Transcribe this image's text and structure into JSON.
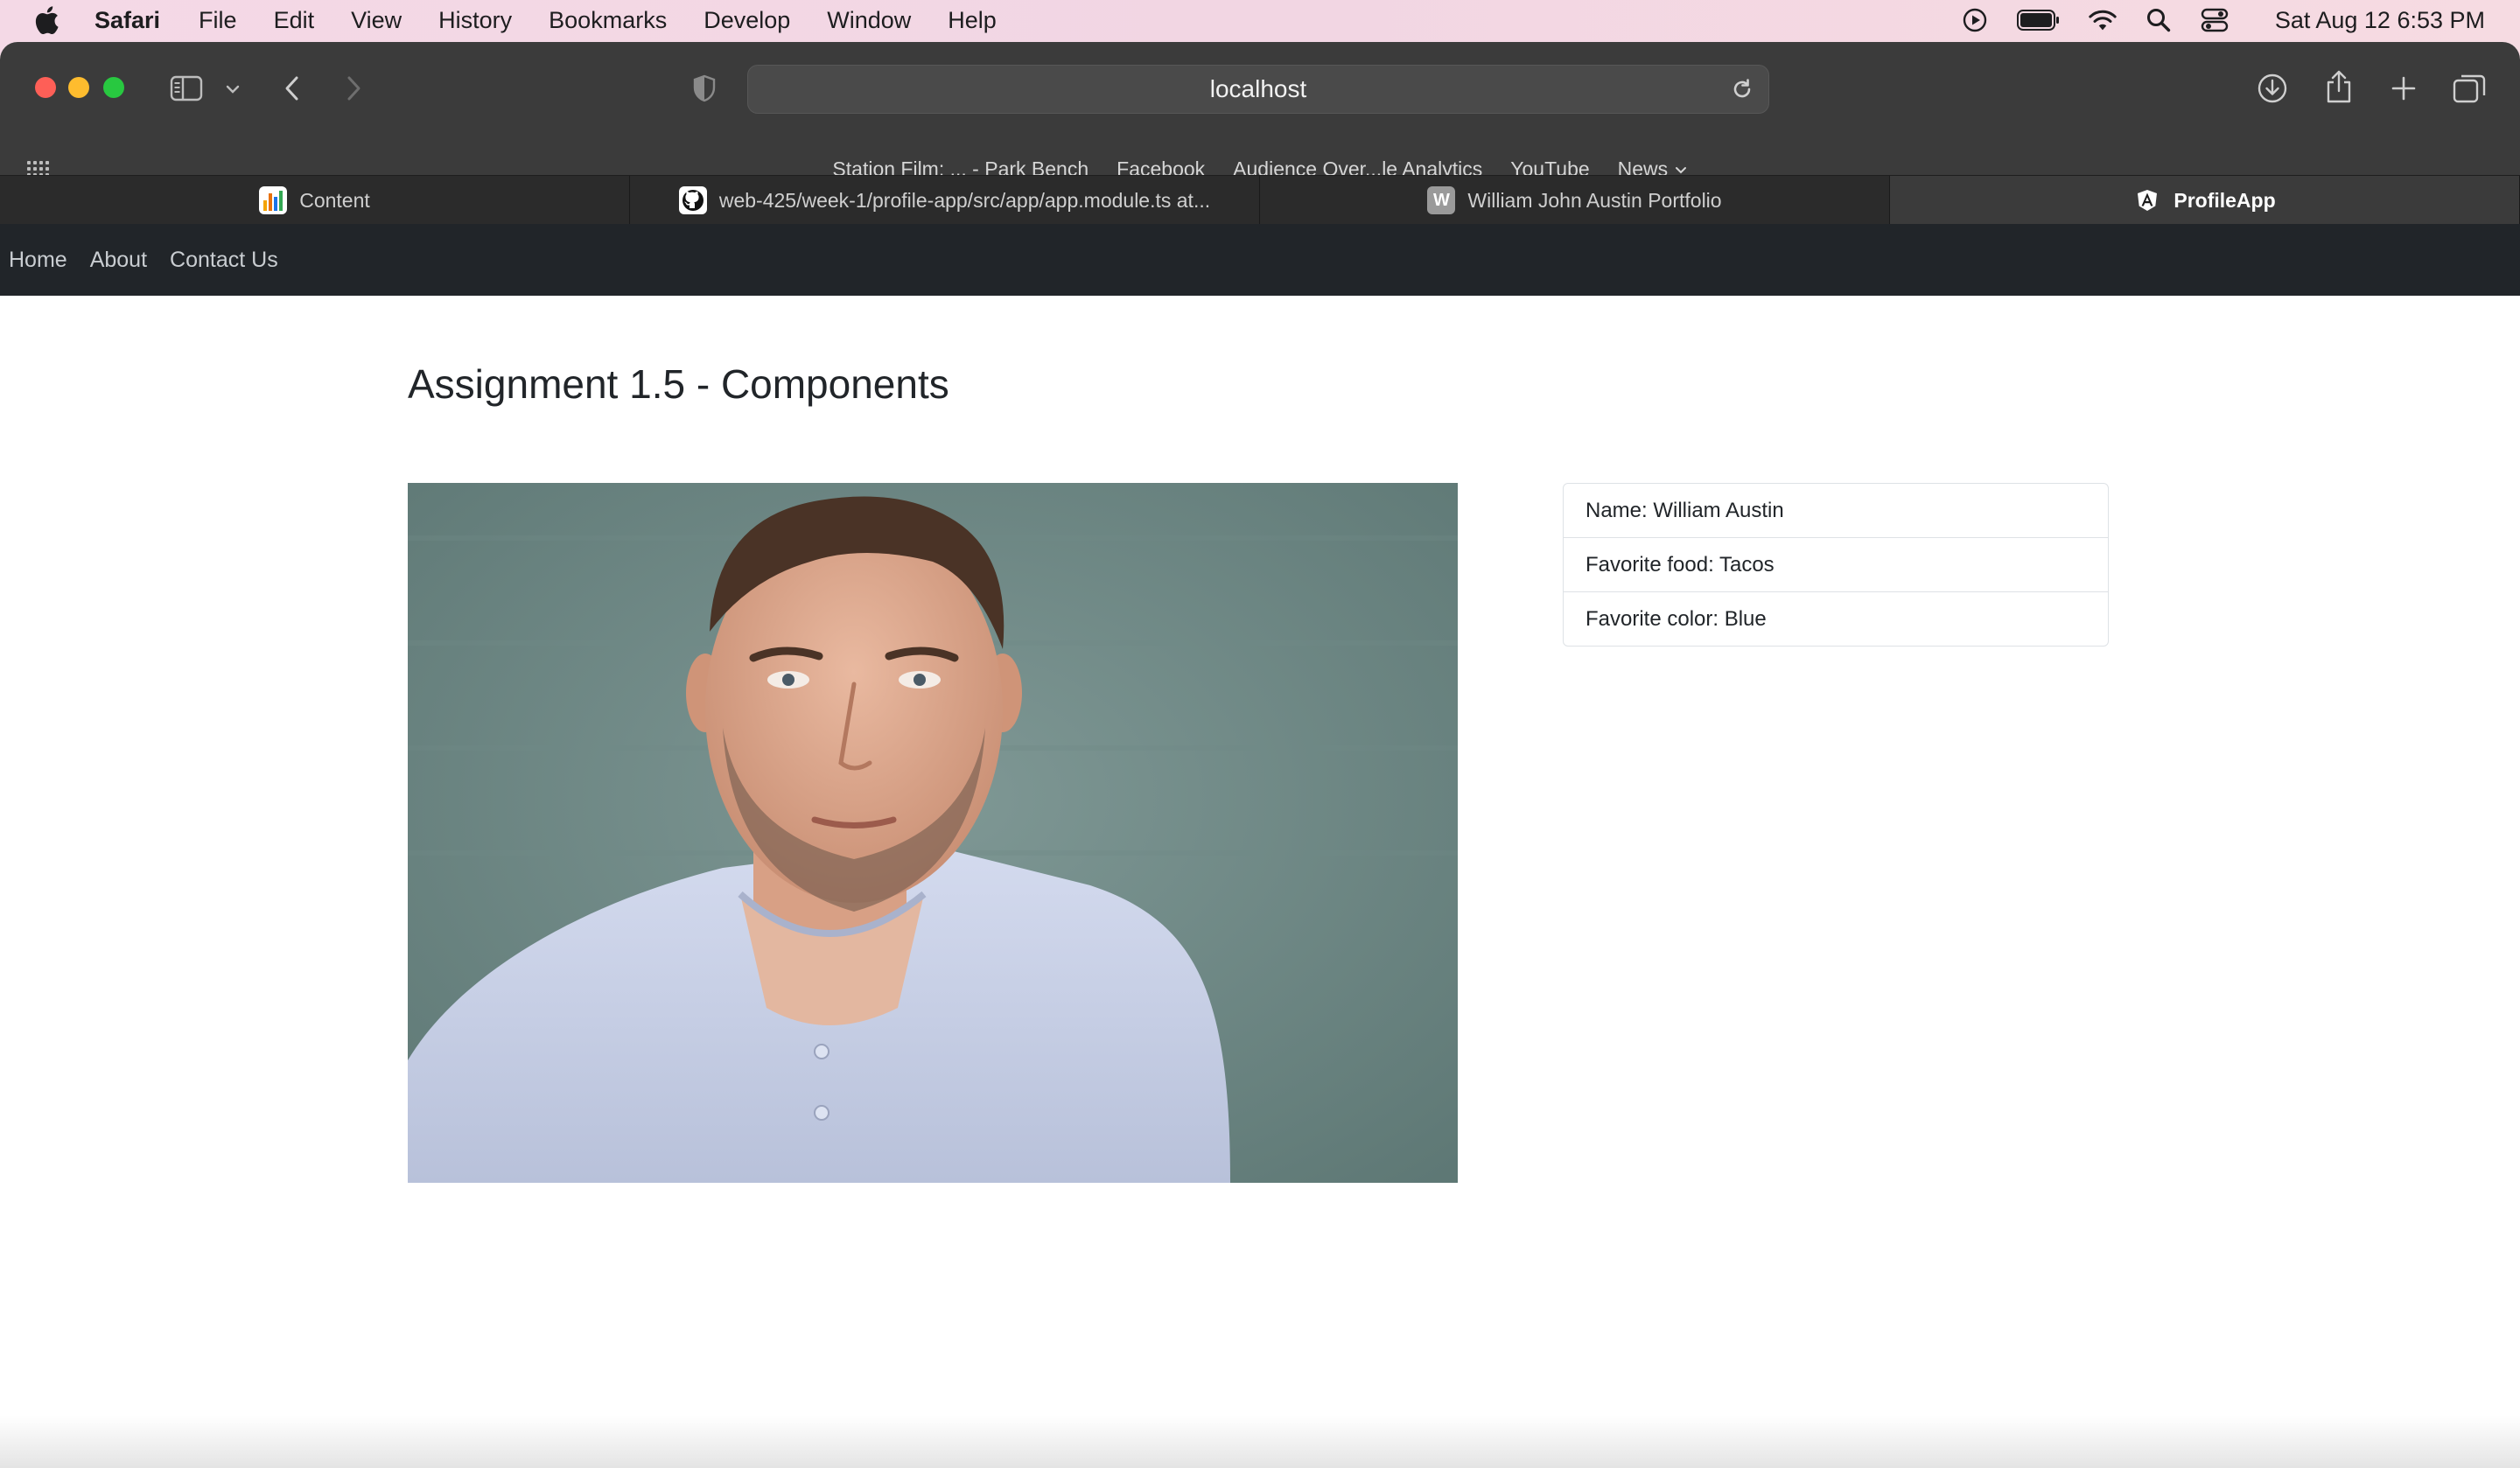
{
  "menubar": {
    "app_name": "Safari",
    "items": [
      "File",
      "Edit",
      "View",
      "History",
      "Bookmarks",
      "Develop",
      "Window",
      "Help"
    ],
    "clock": "Sat Aug 12  6:53 PM"
  },
  "browser": {
    "address": "localhost",
    "favorites": [
      "Station Film: ... - Park Bench",
      "Facebook",
      "Audience Over...le Analytics",
      "YouTube",
      "News"
    ],
    "tabs": [
      {
        "title": "Content",
        "favicon": "bar-chart-icon"
      },
      {
        "title": "web-425/week-1/profile-app/src/app/app.module.ts at...",
        "favicon": "github-icon"
      },
      {
        "title": "William John Austin Portfolio",
        "favicon": "W"
      },
      {
        "title": "ProfileApp",
        "favicon": "angular-icon"
      }
    ],
    "active_tab_index": 3
  },
  "page": {
    "nav": [
      "Home",
      "About",
      "Contact Us"
    ],
    "title": "Assignment 1.5 - Components",
    "profile": [
      "Name: William Austin",
      "Favorite food: Tacos",
      "Favorite color: Blue"
    ]
  },
  "colors": {
    "navbar_bg": "#212529",
    "toolbar_bg": "#3b3b3b",
    "tabbar_bg": "#2b2b2b",
    "photo_bg": "#6f8b88",
    "shirt": "#c9d1e6"
  }
}
